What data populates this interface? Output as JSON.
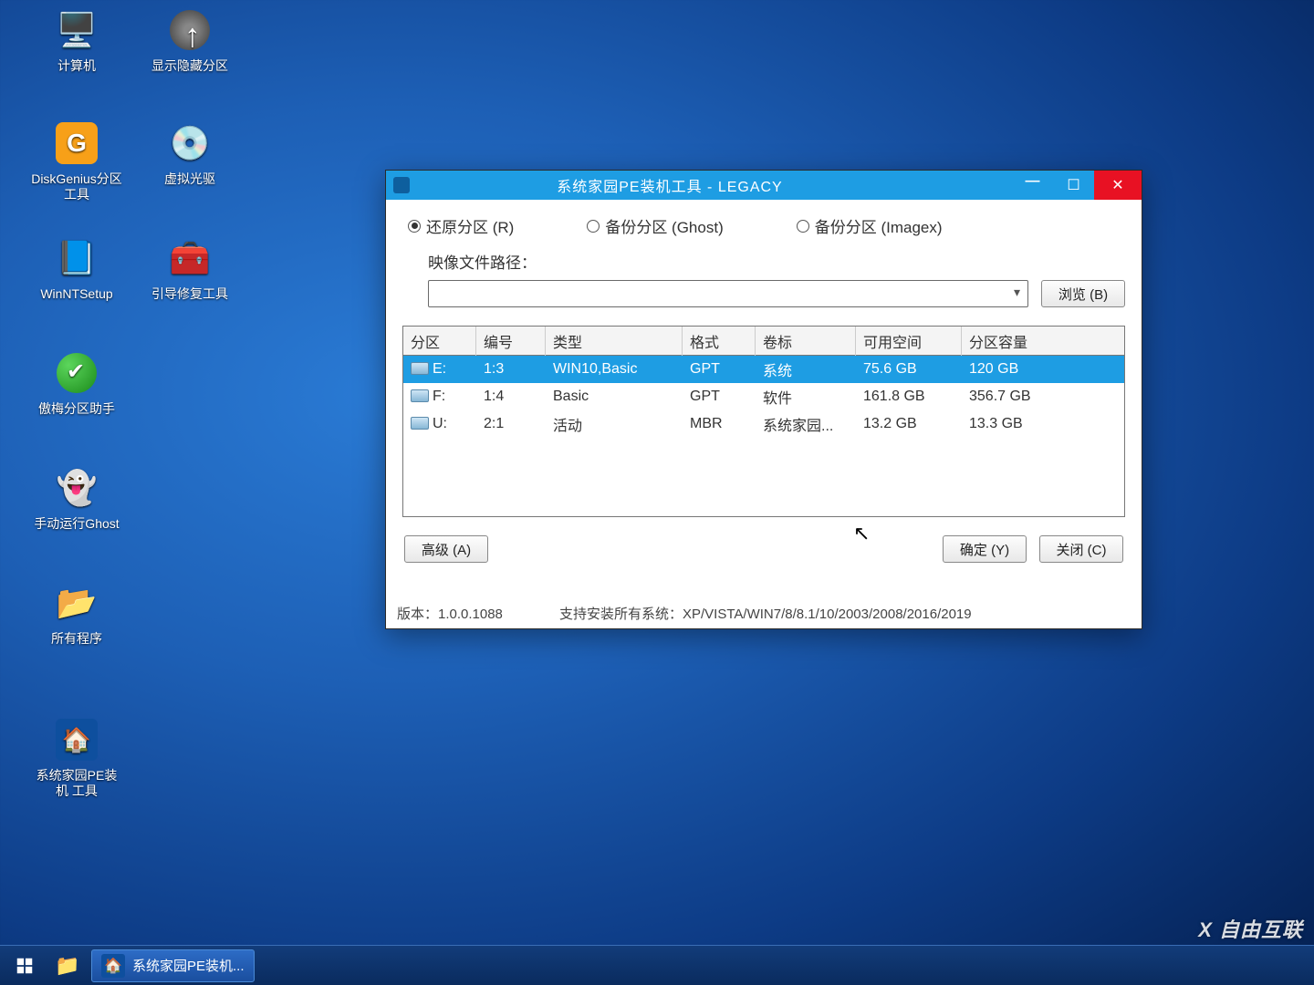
{
  "desktop": {
    "icons": [
      {
        "name": "computer",
        "label": "计算机"
      },
      {
        "name": "show-hidden",
        "label": "显示隐藏分区"
      },
      {
        "name": "diskgenius",
        "label": "DiskGenius分区工具"
      },
      {
        "name": "virtual-cd",
        "label": "虚拟光驱"
      },
      {
        "name": "winntsetup",
        "label": "WinNTSetup"
      },
      {
        "name": "boot-repair",
        "label": "引导修复工具"
      },
      {
        "name": "aomei",
        "label": "傲梅分区助手"
      },
      {
        "name": "ghost-manual",
        "label": "手动运行Ghost"
      },
      {
        "name": "all-programs",
        "label": "所有程序"
      },
      {
        "name": "pe-tool",
        "label": "系统家园PE装机 工具"
      }
    ]
  },
  "window": {
    "title": "系统家园PE装机工具 - LEGACY",
    "radios": {
      "restore": "还原分区 (R)",
      "backup_ghost": "备份分区 (Ghost)",
      "backup_imagex": "备份分区 (Imagex)"
    },
    "image_path_label": "映像文件路径：",
    "browse": "浏览 (B)",
    "columns": [
      "分区",
      "编号",
      "类型",
      "格式",
      "卷标",
      "可用空间",
      "分区容量"
    ],
    "rows": [
      {
        "drive": "E:",
        "num": "1:3",
        "type": "WIN10,Basic",
        "fmt": "GPT",
        "vol": "系统",
        "free": "75.6 GB",
        "size": "120 GB",
        "selected": true
      },
      {
        "drive": "F:",
        "num": "1:4",
        "type": "Basic",
        "fmt": "GPT",
        "vol": "软件",
        "free": "161.8 GB",
        "size": "356.7 GB",
        "selected": false
      },
      {
        "drive": "U:",
        "num": "2:1",
        "type": "活动",
        "fmt": "MBR",
        "vol": "系统家园...",
        "free": "13.2 GB",
        "size": "13.3 GB",
        "selected": false
      }
    ],
    "buttons": {
      "advanced": "高级 (A)",
      "ok": "确定 (Y)",
      "close": "关闭 (C)"
    },
    "version": "版本：1.0.0.1088",
    "support": "支持安装所有系统：XP/VISTA/WIN7/8/8.1/10/2003/2008/2016/2019"
  },
  "taskbar": {
    "active_app": "系统家园PE装机..."
  },
  "watermark": "X 自由互联"
}
